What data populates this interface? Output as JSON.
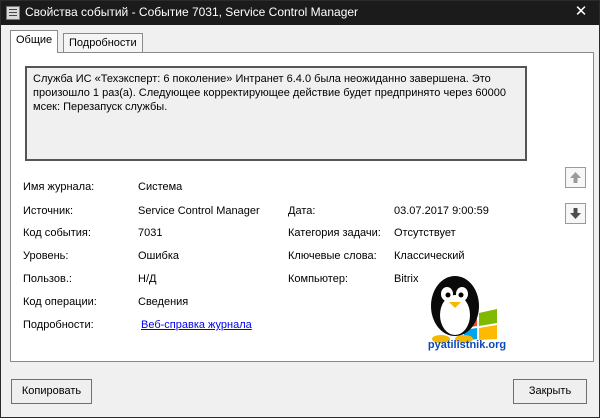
{
  "window": {
    "title": "Свойства событий - Событие 7031, Service Control Manager",
    "close_label": "✕"
  },
  "tabs": [
    {
      "label": "Общие"
    },
    {
      "label": "Подробности"
    }
  ],
  "description": "Служба ИС «Техэксперт: 6 поколение» Интранет 6.4.0 была неожиданно завершена. Это произошло 1 раз(а). Следующее корректирующее действие будет предпринято через 60000 мсек: Перезапуск службы.",
  "fields_left": [
    {
      "label": "Имя журнала:",
      "value": "Система"
    },
    {
      "label": "Источник:",
      "value": "Service Control Manager"
    },
    {
      "label": "Код события:",
      "value": "7031"
    },
    {
      "label": "Уровень:",
      "value": "Ошибка"
    },
    {
      "label": "Пользов.:",
      "value": "Н/Д"
    },
    {
      "label": "Код операции:",
      "value": "Сведения"
    },
    {
      "label": "Подробности:",
      "value": "Веб-справка журнала"
    }
  ],
  "fields_right": [
    {
      "label": "Дата:",
      "value": "03.07.2017 9:00:59"
    },
    {
      "label": "Категория задачи:",
      "value": "Отсутствует"
    },
    {
      "label": "Ключевые слова:",
      "value": "Классический"
    },
    {
      "label": "Компьютер:",
      "value": "Bitrix."
    }
  ],
  "watermark": {
    "text": "pyatilistnik.org",
    "colors": {
      "red": "#f25022",
      "green": "#7fba00",
      "blue": "#00a4ef",
      "yellow": "#ffb900"
    }
  },
  "buttons": {
    "copy": "Копировать",
    "close": "Закрыть",
    "up_icon": "arrow-up-icon",
    "down_icon": "arrow-down-icon"
  }
}
